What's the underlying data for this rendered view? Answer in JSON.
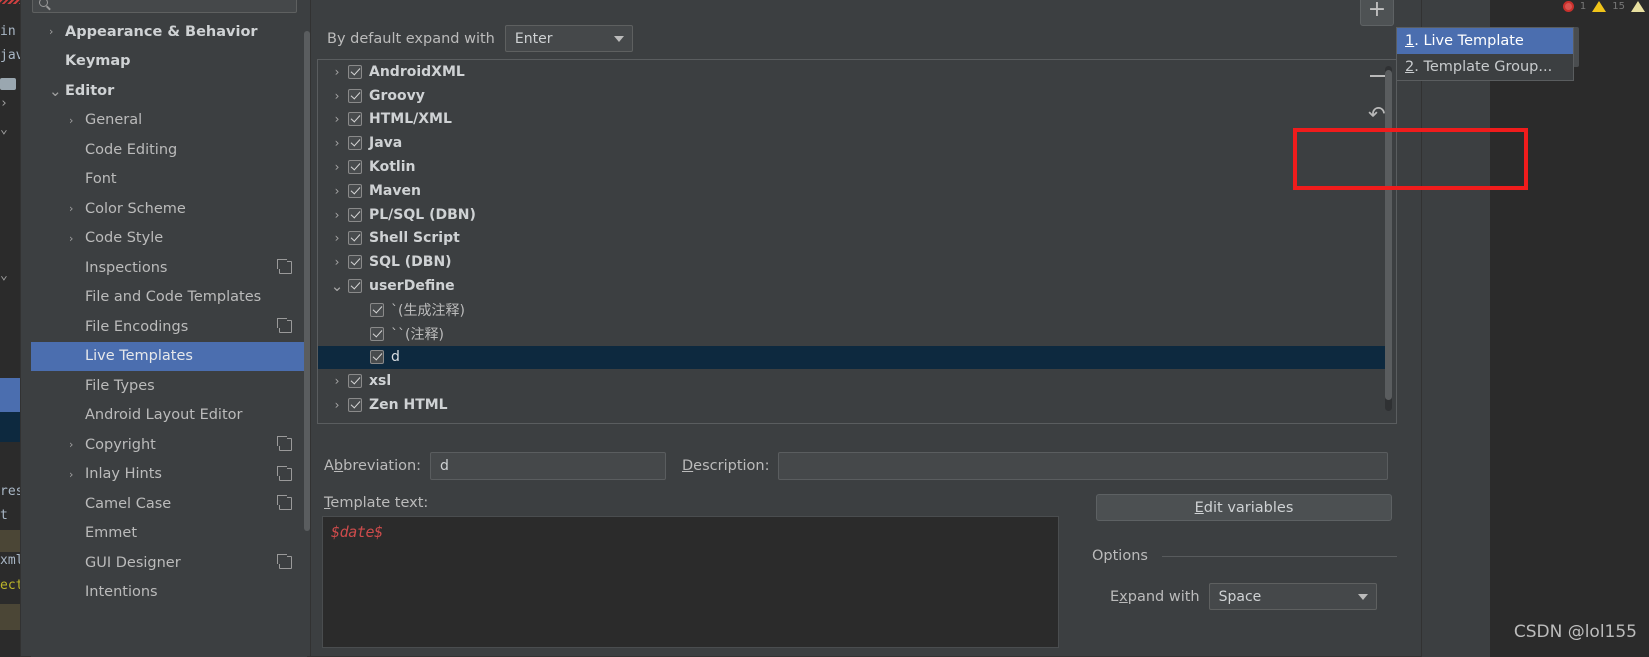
{
  "ide": {
    "code_lines": [
      "in",
      "jav",
      "",
      "",
      "",
      "",
      "",
      "",
      "",
      "res",
      "t",
      "",
      "xml",
      "ect"
    ],
    "inspection": {
      "error_count": "1",
      "warning_count": "15"
    },
    "mini_widget": {
      "glyph": "m",
      "refresh_icon": "refresh-icon",
      "close_icon": "close-icon"
    }
  },
  "dialog": {
    "search": {
      "value": "",
      "placeholder": ""
    },
    "sidebar": {
      "items": [
        {
          "label": "Appearance & Behavior",
          "arrow": "right",
          "bold": true,
          "indent": 0,
          "copy": false,
          "selected": false
        },
        {
          "label": "Keymap",
          "arrow": "none",
          "bold": true,
          "indent": 0,
          "copy": false,
          "selected": false
        },
        {
          "label": "Editor",
          "arrow": "down",
          "bold": true,
          "indent": 0,
          "copy": false,
          "selected": false
        },
        {
          "label": "General",
          "arrow": "right",
          "bold": false,
          "indent": 1,
          "copy": false,
          "selected": false
        },
        {
          "label": "Code Editing",
          "arrow": "none",
          "bold": false,
          "indent": 1,
          "copy": false,
          "selected": false
        },
        {
          "label": "Font",
          "arrow": "none",
          "bold": false,
          "indent": 1,
          "copy": false,
          "selected": false
        },
        {
          "label": "Color Scheme",
          "arrow": "right",
          "bold": false,
          "indent": 1,
          "copy": false,
          "selected": false
        },
        {
          "label": "Code Style",
          "arrow": "right",
          "bold": false,
          "indent": 1,
          "copy": false,
          "selected": false
        },
        {
          "label": "Inspections",
          "arrow": "none",
          "bold": false,
          "indent": 1,
          "copy": true,
          "selected": false
        },
        {
          "label": "File and Code Templates",
          "arrow": "none",
          "bold": false,
          "indent": 1,
          "copy": false,
          "selected": false
        },
        {
          "label": "File Encodings",
          "arrow": "none",
          "bold": false,
          "indent": 1,
          "copy": true,
          "selected": false
        },
        {
          "label": "Live Templates",
          "arrow": "none",
          "bold": false,
          "indent": 1,
          "copy": false,
          "selected": true
        },
        {
          "label": "File Types",
          "arrow": "none",
          "bold": false,
          "indent": 1,
          "copy": false,
          "selected": false
        },
        {
          "label": "Android Layout Editor",
          "arrow": "none",
          "bold": false,
          "indent": 1,
          "copy": false,
          "selected": false
        },
        {
          "label": "Copyright",
          "arrow": "right",
          "bold": false,
          "indent": 1,
          "copy": true,
          "selected": false
        },
        {
          "label": "Inlay Hints",
          "arrow": "right",
          "bold": false,
          "indent": 1,
          "copy": true,
          "selected": false
        },
        {
          "label": "Camel Case",
          "arrow": "none",
          "bold": false,
          "indent": 1,
          "copy": true,
          "selected": false
        },
        {
          "label": "Emmet",
          "arrow": "none",
          "bold": false,
          "indent": 1,
          "copy": false,
          "selected": false
        },
        {
          "label": "GUI Designer",
          "arrow": "none",
          "bold": false,
          "indent": 1,
          "copy": true,
          "selected": false
        },
        {
          "label": "Intentions",
          "arrow": "none",
          "bold": false,
          "indent": 1,
          "copy": false,
          "selected": false
        }
      ]
    },
    "expand_default": {
      "label": "By default expand with",
      "value": "Enter"
    },
    "template_tree": {
      "rows": [
        {
          "label": "AndroidXML",
          "arrow": "right",
          "checked": true,
          "group": true,
          "child": false,
          "selected": false
        },
        {
          "label": "Groovy",
          "arrow": "right",
          "checked": true,
          "group": true,
          "child": false,
          "selected": false
        },
        {
          "label": "HTML/XML",
          "arrow": "right",
          "checked": true,
          "group": true,
          "child": false,
          "selected": false
        },
        {
          "label": "Java",
          "arrow": "right",
          "checked": true,
          "group": true,
          "child": false,
          "selected": false
        },
        {
          "label": "Kotlin",
          "arrow": "right",
          "checked": true,
          "group": true,
          "child": false,
          "selected": false
        },
        {
          "label": "Maven",
          "arrow": "right",
          "checked": true,
          "group": true,
          "child": false,
          "selected": false
        },
        {
          "label": "PL/SQL (DBN)",
          "arrow": "right",
          "checked": true,
          "group": true,
          "child": false,
          "selected": false
        },
        {
          "label": "Shell Script",
          "arrow": "right",
          "checked": true,
          "group": true,
          "child": false,
          "selected": false
        },
        {
          "label": "SQL (DBN)",
          "arrow": "right",
          "checked": true,
          "group": true,
          "child": false,
          "selected": false
        },
        {
          "label": "userDefine",
          "arrow": "down",
          "checked": true,
          "group": true,
          "child": false,
          "selected": false
        },
        {
          "label": "`(生成注释)",
          "arrow": "none",
          "checked": true,
          "group": false,
          "child": true,
          "selected": false
        },
        {
          "label": "``(注释)",
          "arrow": "none",
          "checked": true,
          "group": false,
          "child": true,
          "selected": false
        },
        {
          "label": "d",
          "arrow": "none",
          "checked": true,
          "group": false,
          "child": true,
          "selected": true
        },
        {
          "label": "xsl",
          "arrow": "right",
          "checked": true,
          "group": true,
          "child": false,
          "selected": false
        },
        {
          "label": "Zen HTML",
          "arrow": "right",
          "checked": true,
          "group": true,
          "child": false,
          "selected": false
        }
      ]
    },
    "toolbar": {
      "add_label": "+",
      "remove_label": "−",
      "revert_label": "↺"
    },
    "popup_menu": {
      "items": [
        {
          "mnemonic": "1",
          "label": ". Live Template",
          "highlighted": true
        },
        {
          "mnemonic": "2",
          "label": ". Template Group...",
          "highlighted": false
        }
      ]
    },
    "form": {
      "abbreviation_label_prefix": "A",
      "abbreviation_label_mnemonic": "b",
      "abbreviation_label_suffix": "breviation:",
      "abbreviation_value": "d",
      "description_label_mnemonic": "D",
      "description_label_suffix": "escription:",
      "description_value": "",
      "template_text_label_mnemonic": "T",
      "template_text_label_suffix": "emplate text:",
      "template_text_value": "$date$",
      "edit_variables_mnemonic": "E",
      "edit_variables_suffix": "dit variables",
      "options_title": "Options",
      "expand_with_prefix": "E",
      "expand_with_mnemonic": "x",
      "expand_with_suffix": "pand with",
      "expand_with_value": "Space"
    }
  },
  "watermark": "CSDN @lol155",
  "colors": {
    "accent_selection": "#4b6eaf",
    "tree_selection": "#0d293f",
    "annotation_red": "#f01c1c",
    "code_red": "#cc4b4b",
    "panel_bg": "#3c3f41",
    "editor_bg": "#2b2b2b"
  }
}
